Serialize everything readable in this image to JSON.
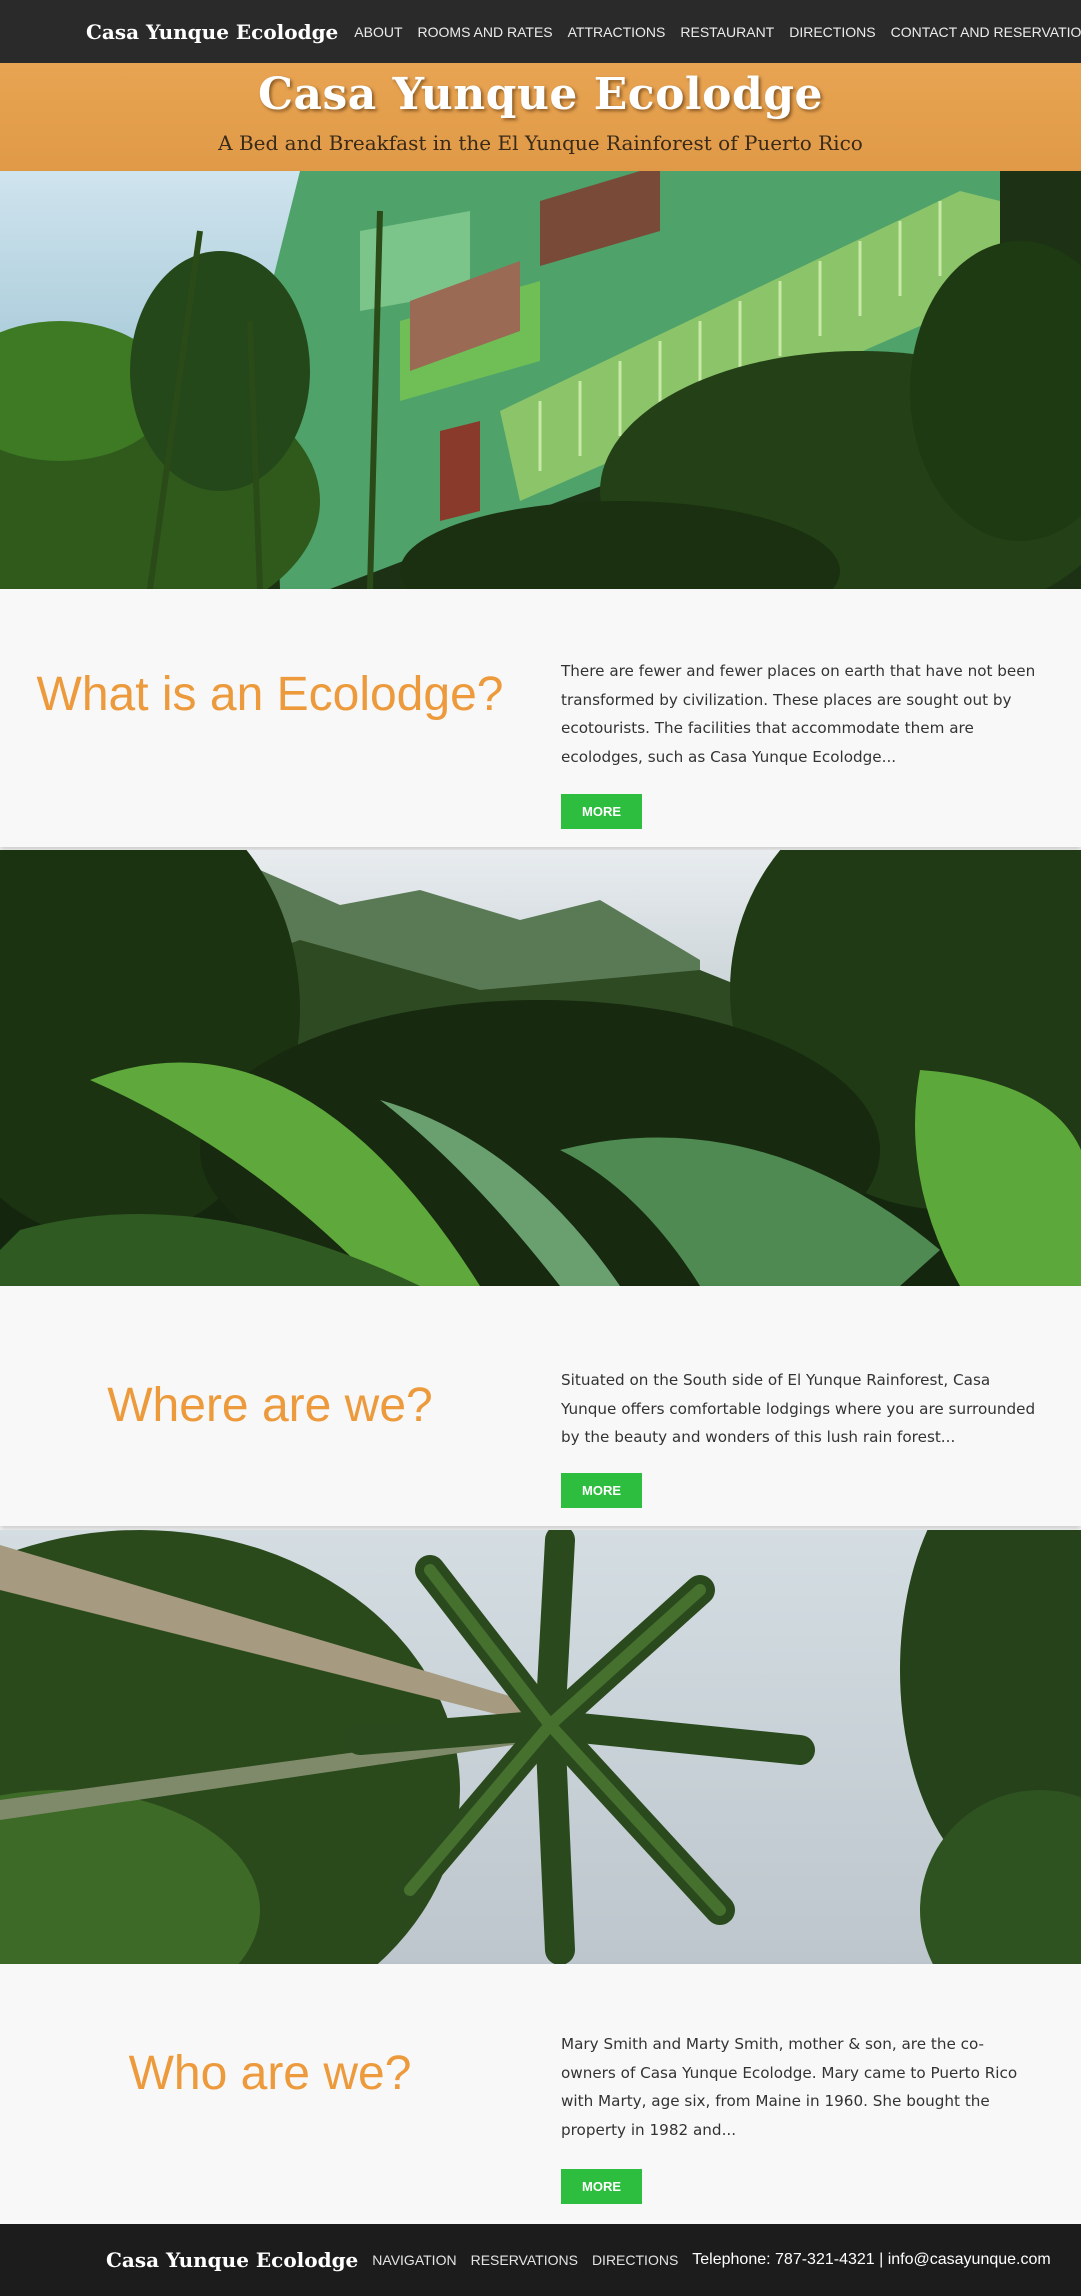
{
  "nav": {
    "brand": "Casa Yunque Ecolodge",
    "links": [
      "ABOUT",
      "ROOMS AND RATES",
      "ATTRACTIONS",
      "RESTAURANT",
      "DIRECTIONS",
      "CONTACT AND RESERVATIONS"
    ]
  },
  "header": {
    "title": "Casa Yunque Ecolodge",
    "tagline": "A Bed and Breakfast in the El Yunque Rainforest of Puerto Rico"
  },
  "sections": [
    {
      "heading": "What is an Ecolodge?",
      "text": "There are fewer and fewer places on earth that have not been transformed by civilization. These places are sought out by ecotourists. The facilities that accommodate them are ecolodges, such as Casa Yunque Ecolodge...",
      "button": "MORE"
    },
    {
      "heading": "Where are we?",
      "text": "Situated on the South side of El Yunque Rainforest, Casa Yunque offers comfortable lodgings where you are surrounded by the beauty and wonders of this lush rain forest...",
      "button": "MORE"
    },
    {
      "heading": "Who are we?",
      "text": "Mary Smith and Marty Smith, mother & son, are the co-owners of Casa Yunque Ecolodge.  Mary came to Puerto Rico with Marty, age six, from Maine in 1960.  She bought the property in 1982 and...",
      "button": "MORE"
    }
  ],
  "footer": {
    "brand": "Casa Yunque Ecolodge",
    "links": [
      "NAVIGATION",
      "RESERVATIONS",
      "DIRECTIONS"
    ],
    "contact": "Telephone: 787-321-4321 | info@casayunque.com"
  },
  "colors": {
    "nav_bg": "#2a2a2a",
    "header_band": "#e09a47",
    "heading_orange": "#ec9a3b",
    "button_green": "#2dbd3f",
    "footer_bg": "#1c1c1c"
  }
}
